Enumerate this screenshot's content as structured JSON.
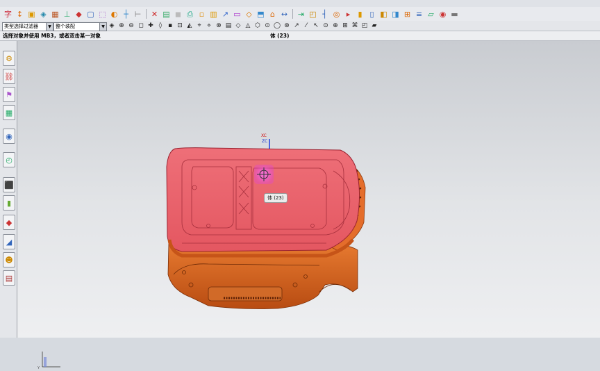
{
  "toolbar": {
    "filter_select": "类型选择过滤器",
    "scope_select": "整个装配"
  },
  "status": {
    "prompt": "选择对象并使用 MB3，或者双击某一对象",
    "selection_info": "体 (23)"
  },
  "viewport": {
    "tooltip": "体 (23)",
    "axis_x": "XC",
    "axis_z": "ZC"
  },
  "colors": {
    "highlight": "#e8606a",
    "body": "#d9621f",
    "pick_marker": "#e040e0"
  },
  "icons": {
    "top_row": [
      "sketch-icon",
      "datum-icon",
      "extrude-icon",
      "revolve-icon",
      "pattern-icon",
      "boolean-icon",
      "shell-icon",
      "edge-blend-icon",
      "chamfer-icon",
      "draft-icon",
      "trim-icon",
      "sew-icon",
      "measure-icon",
      "section-icon",
      "move-icon",
      "snap-icon"
    ],
    "selection_row": [
      "select-all-icon",
      "feature-select-icon",
      "body-select-icon",
      "face-select-icon",
      "point-snap-icon",
      "line-snap-icon",
      "arc-snap-icon",
      "center-snap-icon",
      "tangent-snap-icon"
    ],
    "sidebar": [
      "assembly-navigator-icon",
      "constraint-navigator-icon",
      "part-navigator-icon",
      "reuse-library-icon",
      "web-browser-icon",
      "history-icon",
      "system-materials-icon",
      "process-studio-icon",
      "manufacturing-wizard-icon",
      "roles-icon",
      "palette-icon",
      "system-scenes-icon"
    ]
  }
}
